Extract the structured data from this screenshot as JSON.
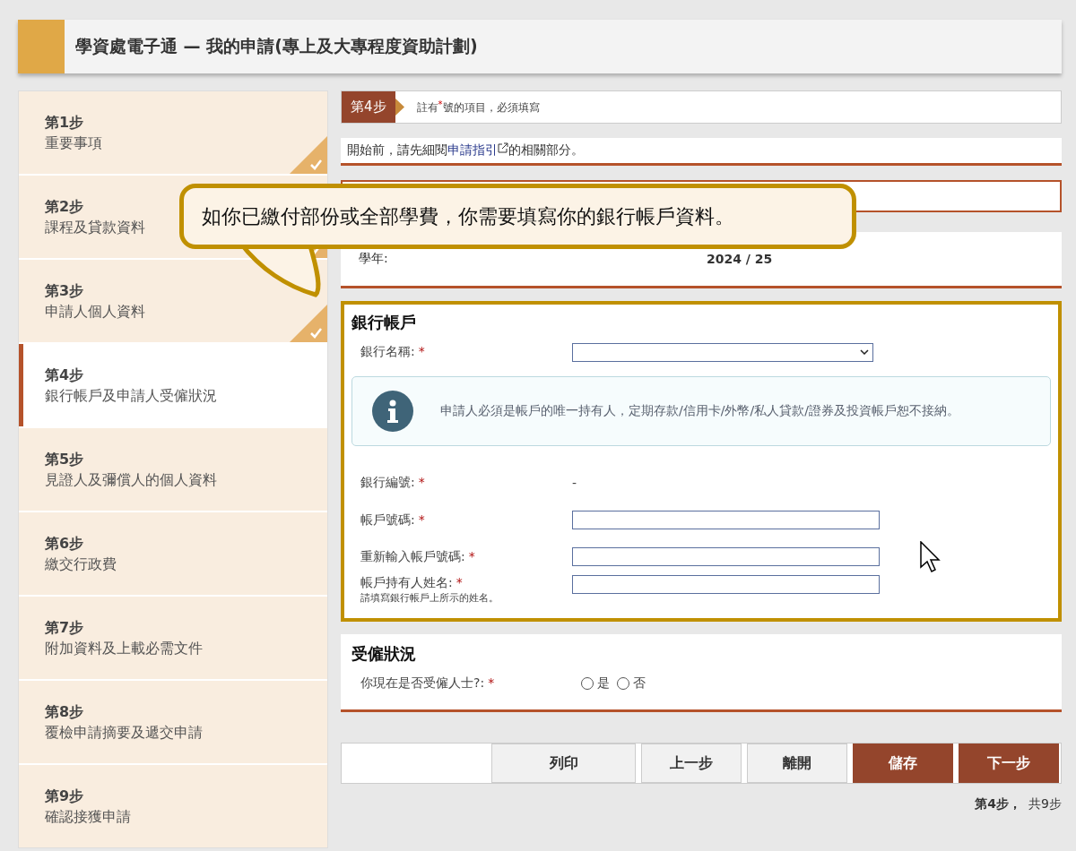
{
  "header": {
    "title": "學資處電子通 — 我的申請(專上及大專程度資助計劃)"
  },
  "steps": [
    {
      "number": "第1步",
      "title": "重要事項",
      "done": true,
      "selected": false
    },
    {
      "number": "第2步",
      "title": "課程及貸款資料",
      "done": true,
      "selected": false
    },
    {
      "number": "第3步",
      "title": "申請人個人資料",
      "done": true,
      "selected": false
    },
    {
      "number": "第4步",
      "title": "銀行帳戶及申請人受僱狀況",
      "done": false,
      "selected": true
    },
    {
      "number": "第5步",
      "title": "見證人及彌償人的個人資料",
      "done": false,
      "selected": false
    },
    {
      "number": "第6步",
      "title": "繳交行政費",
      "done": false,
      "selected": false
    },
    {
      "number": "第7步",
      "title": "附加資料及上載必需文件",
      "done": false,
      "selected": false
    },
    {
      "number": "第8步",
      "title": "覆檢申請摘要及遞交申請",
      "done": false,
      "selected": false
    },
    {
      "number": "第9步",
      "title": "確認接獲申請",
      "done": false,
      "selected": false
    }
  ],
  "step_bar": {
    "badge": "第4步",
    "note": "註有$^{*}$號的項目，必須填寫"
  },
  "intro": {
    "before": "開始前，請先細閱",
    "link": "申請指引",
    "after": "的相關部分。"
  },
  "callout": {
    "text": "如你已繳付部份或全部學費，你需要填寫你的銀行帳戶資料。"
  },
  "academic_year": {
    "label": "學年:",
    "value": "2024 / 25"
  },
  "bank_account": {
    "heading": "銀行帳戶",
    "fields": [
      {
        "kind": "select",
        "label": "銀行名稱:",
        "mark": "*"
      },
      {
        "kind": "notice",
        "text": "申請人必須是帳戶的唯一持有人，定期存款/信用卡/外幣/私人貸款/證券及投資帳戶恕不接納。"
      },
      {
        "kind": "static",
        "label": "銀行編號:",
        "mark": "*",
        "value": "-"
      },
      {
        "kind": "input",
        "label": "帳戶號碼:",
        "mark": "*"
      },
      {
        "kind": "input",
        "label": "重新輸入帳戶號碼:",
        "mark": "*"
      },
      {
        "kind": "input",
        "label": "帳戶持有人姓名:",
        "mark": "*",
        "hint": "請填寫銀行帳戶上所示的姓名。"
      }
    ]
  },
  "employment": {
    "heading": "受僱狀況",
    "question": "你現在是否受僱人士?:",
    "mark": "*",
    "options": [
      {
        "label": "是",
        "selected": false
      },
      {
        "label": "否",
        "selected": false
      }
    ]
  },
  "buttons": [
    {
      "label": "列印",
      "kind": "secondary"
    },
    {
      "label": "上一步",
      "kind": "secondary"
    },
    {
      "label": "離開",
      "kind": "secondary"
    },
    {
      "label": "儲存",
      "kind": "primary"
    },
    {
      "label": "下一步",
      "kind": "primary"
    }
  ],
  "progress": {
    "current": "第4步，",
    "total": "共9步"
  }
}
